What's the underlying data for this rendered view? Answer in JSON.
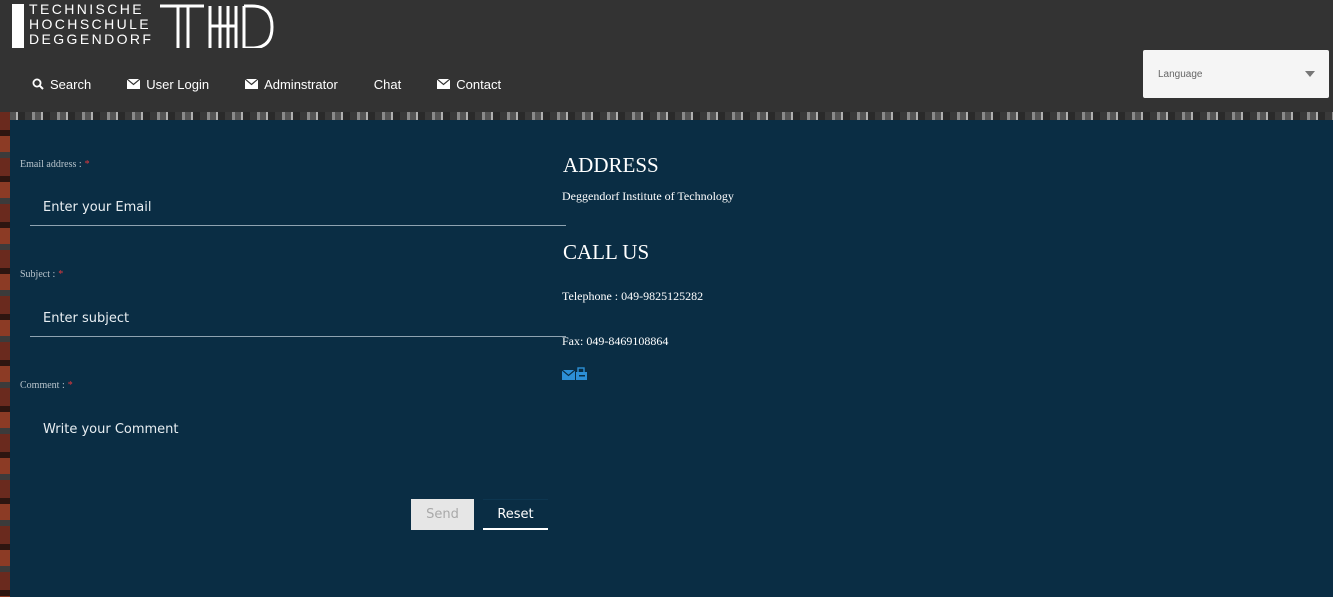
{
  "header": {
    "logo_text": "TECHNISCHE\nHOCHSCHULE\nDEGGENDORF",
    "nav": [
      {
        "label": "Search",
        "icon": "search-icon"
      },
      {
        "label": "User Login",
        "icon": "envelope-icon"
      },
      {
        "label": "Adminstrator",
        "icon": "envelope-icon"
      },
      {
        "label": "Chat",
        "icon": ""
      },
      {
        "label": "Contact",
        "icon": "envelope-icon"
      }
    ],
    "language": {
      "label": "Language"
    }
  },
  "form": {
    "email_label": "Email address :",
    "email_placeholder": "Enter your Email",
    "subject_label": "Subject :",
    "subject_placeholder": "Enter subject",
    "comment_label": "Comment :",
    "comment_placeholder": "Write your Comment",
    "required_mark": "*",
    "send_label": "Send",
    "reset_label": "Reset"
  },
  "contact": {
    "address_heading": "ADDRESS",
    "address_text": "Deggendorf Institute of Technology",
    "call_heading": "CALL US",
    "telephone": "Telephone : 049-9825125282",
    "fax": "Fax: 049-8469108864",
    "fax_icon": "fax-mail-icon"
  },
  "colors": {
    "header_bg": "#333333",
    "page_bg": "#0a2d44",
    "required": "#e0393e",
    "icon_blue": "#2c8fd6"
  }
}
